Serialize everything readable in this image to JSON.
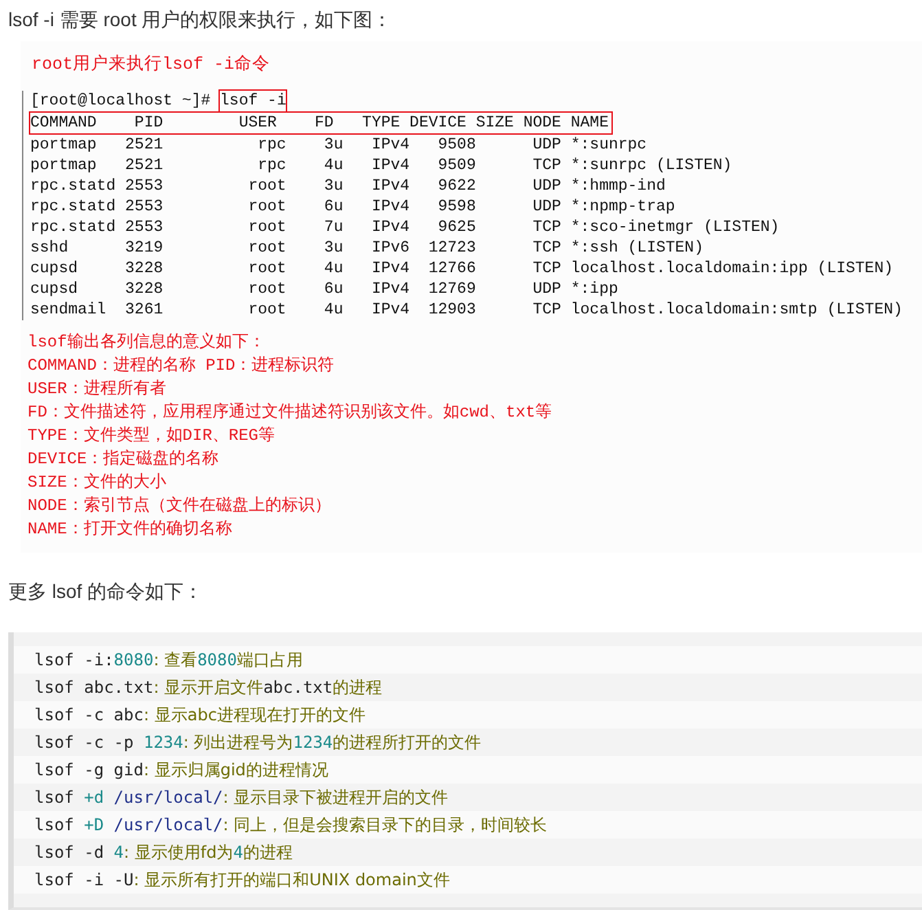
{
  "intro": "lsof -i 需要 root 用户的权限来执行，如下图：",
  "figure": {
    "caption": "root用户来执行lsof -i命令",
    "prompt": "[root@localhost ~]# ",
    "command": "lsof -i",
    "header": "COMMAND    PID        USER    FD   TYPE DEVICE SIZE NODE NAME",
    "rows": [
      {
        "command": "portmap",
        "pid": "2521",
        "user": "rpc",
        "fd": "3u",
        "type": "IPv4",
        "device": "9508",
        "node": "UDP",
        "name": "*:sunrpc"
      },
      {
        "command": "portmap",
        "pid": "2521",
        "user": "rpc",
        "fd": "4u",
        "type": "IPv4",
        "device": "9509",
        "node": "TCP",
        "name": "*:sunrpc (LISTEN)"
      },
      {
        "command": "rpc.statd",
        "pid": "2553",
        "user": "root",
        "fd": "3u",
        "type": "IPv4",
        "device": "9622",
        "node": "UDP",
        "name": "*:hmmp-ind"
      },
      {
        "command": "rpc.statd",
        "pid": "2553",
        "user": "root",
        "fd": "6u",
        "type": "IPv4",
        "device": "9598",
        "node": "UDP",
        "name": "*:npmp-trap"
      },
      {
        "command": "rpc.statd",
        "pid": "2553",
        "user": "root",
        "fd": "7u",
        "type": "IPv4",
        "device": "9625",
        "node": "TCP",
        "name": "*:sco-inetmgr (LISTEN)"
      },
      {
        "command": "sshd",
        "pid": "3219",
        "user": "root",
        "fd": "3u",
        "type": "IPv6",
        "device": "12723",
        "node": "TCP",
        "name": "*:ssh (LISTEN)"
      },
      {
        "command": "cupsd",
        "pid": "3228",
        "user": "root",
        "fd": "4u",
        "type": "IPv4",
        "device": "12766",
        "node": "TCP",
        "name": "localhost.localdomain:ipp (LISTEN)"
      },
      {
        "command": "cupsd",
        "pid": "3228",
        "user": "root",
        "fd": "6u",
        "type": "IPv4",
        "device": "12769",
        "node": "UDP",
        "name": "*:ipp"
      },
      {
        "command": "sendmail",
        "pid": "3261",
        "user": "root",
        "fd": "4u",
        "type": "IPv4",
        "device": "12903",
        "node": "TCP",
        "name": "localhost.localdomain:smtp (LISTEN)"
      }
    ],
    "notes": [
      "lsof输出各列信息的意义如下：",
      "COMMAND：进程的名称 PID：进程标识符",
      "USER：进程所有者",
      "FD：文件描述符，应用程序通过文件描述符识别该文件。如cwd、txt等",
      "TYPE：文件类型，如DIR、REG等",
      "DEVICE：指定磁盘的名称",
      "SIZE：文件的大小",
      "NODE：索引节点（文件在磁盘上的标识）",
      "NAME：打开文件的确切名称"
    ]
  },
  "more_heading": "更多 lsof 的命令如下：",
  "code_lines": [
    [
      {
        "kind": "cmd",
        "text": "lsof -i:"
      },
      {
        "kind": "num",
        "text": "8080"
      },
      {
        "kind": "desc",
        "text": ": 查看"
      },
      {
        "kind": "num",
        "text": "8080"
      },
      {
        "kind": "desc",
        "text": "端口占用"
      }
    ],
    [
      {
        "kind": "cmd",
        "text": "lsof abc.txt"
      },
      {
        "kind": "desc",
        "text": ": 显示开启文件"
      },
      {
        "kind": "cmd",
        "text": "abc.txt"
      },
      {
        "kind": "desc",
        "text": "的进程"
      }
    ],
    [
      {
        "kind": "cmd",
        "text": "lsof -c abc"
      },
      {
        "kind": "desc",
        "text": ": 显示abc进程现在打开的文件"
      }
    ],
    [
      {
        "kind": "cmd",
        "text": "lsof -c -p "
      },
      {
        "kind": "num",
        "text": "1234"
      },
      {
        "kind": "desc",
        "text": ": 列出进程号为"
      },
      {
        "kind": "num",
        "text": "1234"
      },
      {
        "kind": "desc",
        "text": "的进程所打开的文件"
      }
    ],
    [
      {
        "kind": "cmd",
        "text": "lsof -g gid"
      },
      {
        "kind": "desc",
        "text": ": 显示归属gid的进程情况"
      }
    ],
    [
      {
        "kind": "cmd",
        "text": "lsof "
      },
      {
        "kind": "num",
        "text": "+d"
      },
      {
        "kind": "path",
        "text": " /usr/local/"
      },
      {
        "kind": "desc",
        "text": ": 显示目录下被进程开启的文件"
      }
    ],
    [
      {
        "kind": "cmd",
        "text": "lsof "
      },
      {
        "kind": "num",
        "text": "+D"
      },
      {
        "kind": "path",
        "text": " /usr/local/"
      },
      {
        "kind": "desc",
        "text": ": 同上，但是会搜索目录下的目录，时间较长"
      }
    ],
    [
      {
        "kind": "cmd",
        "text": "lsof -d "
      },
      {
        "kind": "num",
        "text": "4"
      },
      {
        "kind": "desc",
        "text": ": 显示使用fd为"
      },
      {
        "kind": "num",
        "text": "4"
      },
      {
        "kind": "desc",
        "text": "的进程"
      }
    ],
    [
      {
        "kind": "cmd",
        "text": "lsof -i -U"
      },
      {
        "kind": "desc",
        "text": ": 显示所有打开的端口和UNIX domain文件"
      }
    ]
  ]
}
